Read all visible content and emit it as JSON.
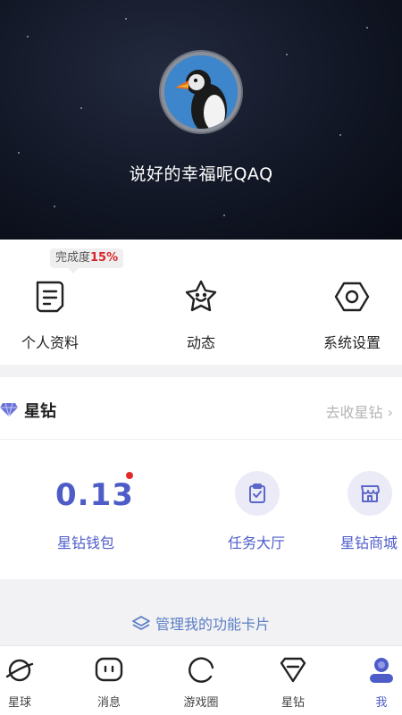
{
  "profile": {
    "username": "说好的幸福呢QAQ",
    "completion_label": "完成度",
    "completion_value": "15%"
  },
  "actions": [
    {
      "label": "个人资料",
      "icon": "document-icon"
    },
    {
      "label": "动态",
      "icon": "smile-star-icon"
    },
    {
      "label": "系统设置",
      "icon": "hexagon-settings-icon"
    }
  ],
  "diamond": {
    "title": "星钻",
    "link": "去收星钻",
    "balance": "0.13",
    "wallet_label": "星钻钱包",
    "task_label": "任务大厅",
    "mall_label": "星钻商城"
  },
  "manage": {
    "label": "管理我的功能卡片"
  },
  "tabs": [
    {
      "label": "星球",
      "icon": "planet-icon"
    },
    {
      "label": "消息",
      "icon": "chat-icon"
    },
    {
      "label": "游戏圈",
      "icon": "circle-icon"
    },
    {
      "label": "星钻",
      "icon": "diamond-icon"
    },
    {
      "label": "我",
      "icon": "user-icon",
      "active": true
    }
  ],
  "colors": {
    "accent": "#4e5cc8",
    "red": "#d9262c"
  }
}
